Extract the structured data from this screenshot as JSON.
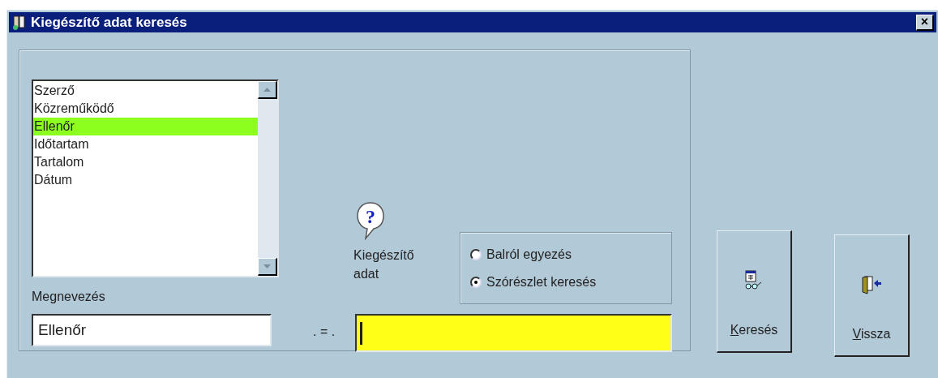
{
  "window": {
    "title": "Kiegészítő adat keresés",
    "close": "×"
  },
  "list": {
    "items": [
      {
        "label": "Szerző",
        "selected": false
      },
      {
        "label": "Közreműködő",
        "selected": false
      },
      {
        "label": "Ellenőr",
        "selected": true
      },
      {
        "label": "Időtartam",
        "selected": false
      },
      {
        "label": "Tartalom",
        "selected": false
      },
      {
        "label": "Dátum",
        "selected": false
      }
    ]
  },
  "name_label": "Megnevezés",
  "name_value": "Ellenőr",
  "operator": ". = .",
  "help_icon": "?",
  "value_label": "Kiegészítő adat",
  "match_options": [
    {
      "label": "Balról egyezés",
      "selected": false
    },
    {
      "label": "Szórészlet keresés",
      "selected": true
    }
  ],
  "buttons": [
    {
      "kind": "search",
      "label": "Keresés"
    },
    {
      "kind": "back",
      "label": "Vissza"
    }
  ]
}
